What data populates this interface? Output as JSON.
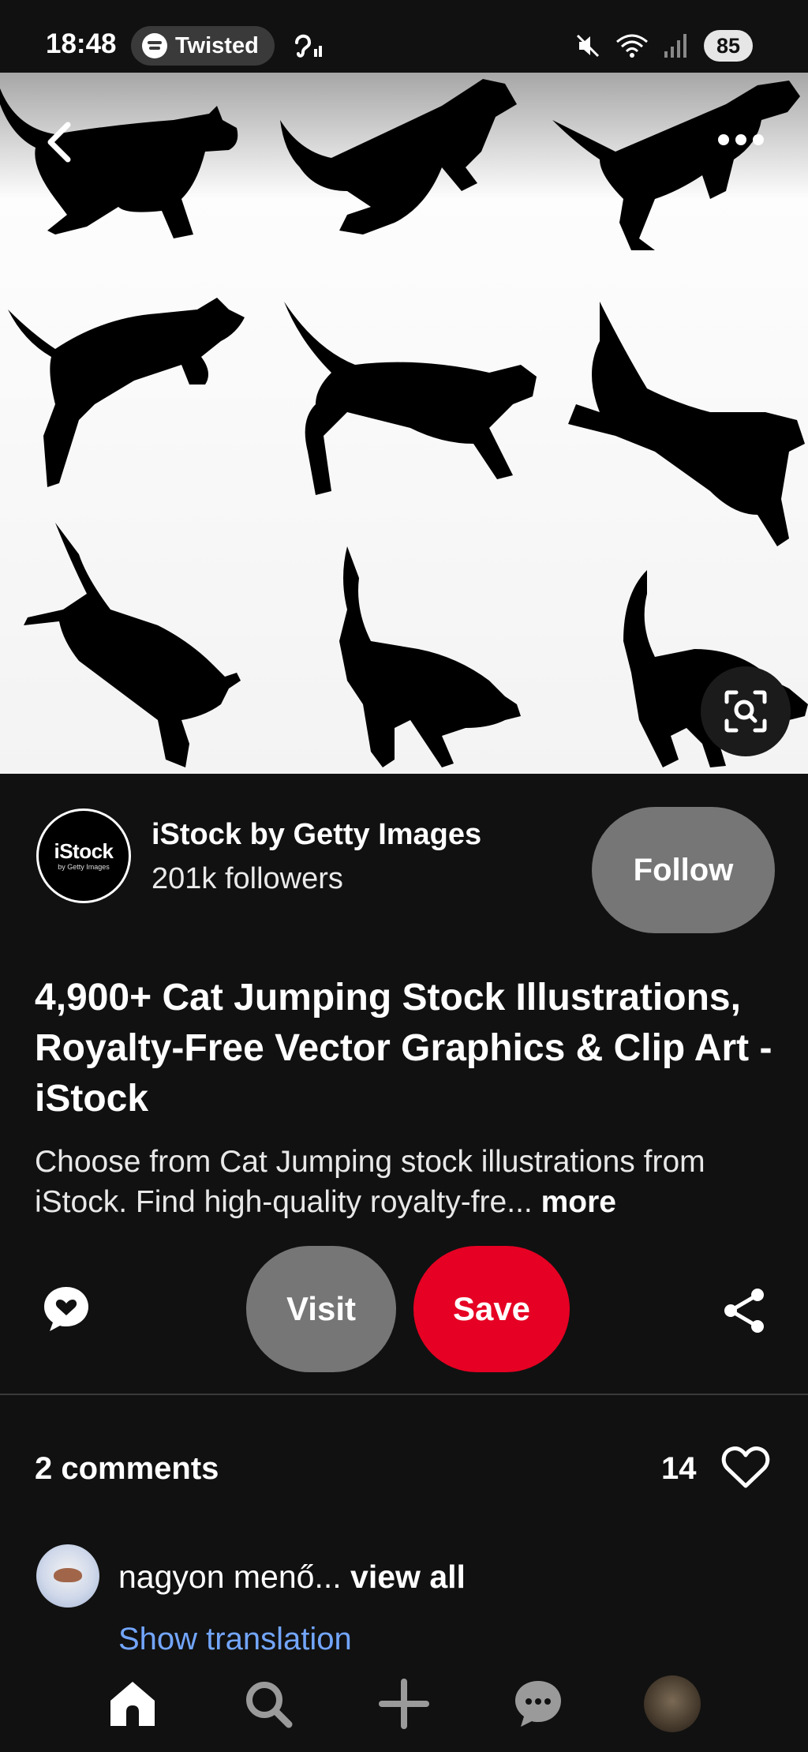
{
  "status_bar": {
    "time": "18:48",
    "now_playing": "Twisted",
    "battery": "85"
  },
  "creator": {
    "avatar_logo": "iStock",
    "avatar_logo_sub": "by Getty Images",
    "name": "iStock by Getty Images",
    "followers": "201k followers",
    "follow_label": "Follow"
  },
  "pin": {
    "title": "4,900+ Cat Jumping Stock Illustrations, Royalty-Free Vector Graphics & Clip Art - iStock",
    "description": "Choose from  Cat Jumping stock illustrations from iStock. Find high-quality royalty-fre...",
    "more_label": "more"
  },
  "actions": {
    "visit_label": "Visit",
    "save_label": "Save"
  },
  "comments": {
    "count_label": "2 comments",
    "likes": "14",
    "preview_text": "nagyon menő...",
    "view_all_label": "view all",
    "show_translation_label": "Show translation"
  },
  "icons": {
    "back": "chevron-left-icon",
    "more": "more-dots-icon",
    "lens": "visual-search-icon",
    "comment": "comment-icon",
    "share": "share-icon",
    "heart": "heart-icon",
    "nav": [
      "home-icon",
      "search-icon",
      "plus-icon",
      "messages-icon",
      "profile-avatar"
    ]
  },
  "colors": {
    "background": "#111111",
    "save_red": "#e60023",
    "secondary_button": "#767676",
    "link_blue": "#73a6ff"
  }
}
